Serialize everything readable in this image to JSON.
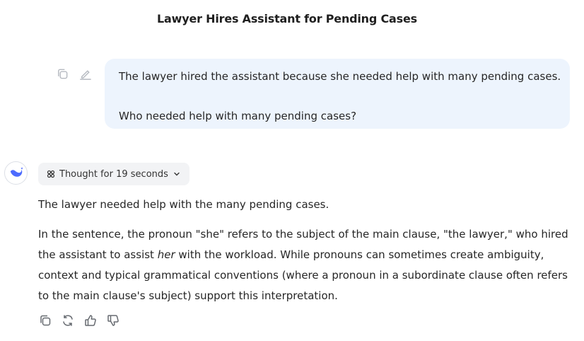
{
  "conversation": {
    "title": "Lawyer Hires Assistant for Pending Cases"
  },
  "user_message": {
    "line1": "The lawyer hired the assistant because she needed help with many pending cases.",
    "line2": "Who needed help with many pending cases?",
    "tool_icons": [
      "copy-icon",
      "edit-icon"
    ]
  },
  "assistant": {
    "avatar_icon": "whale-logo-icon",
    "thought_label": "Thought for 19 seconds",
    "paragraph1": "The lawyer needed help with the many pending cases.",
    "p2_line1": "In the sentence, the pronoun \"she\" refers to the subject of the main clause, \"the lawyer,\" who hired",
    "p2_line2_before": "the assistant to assist ",
    "p2_line2_em": "her",
    "p2_line2_after": " with the workload. While pronouns can sometimes create ambiguity,",
    "p2_line3": "context and typical grammatical conventions (where a pronoun in a subordinate clause often refers",
    "p2_line4": "to the main clause's subject) support this interpretation.",
    "action_icons": [
      "copy-icon",
      "regenerate-icon",
      "thumbs-up-icon",
      "thumbs-down-icon"
    ]
  },
  "colors": {
    "user_bubble": "#edf4fd",
    "brand_blue": "#4d6bfe",
    "icon_gray": "#9aa0a6"
  }
}
